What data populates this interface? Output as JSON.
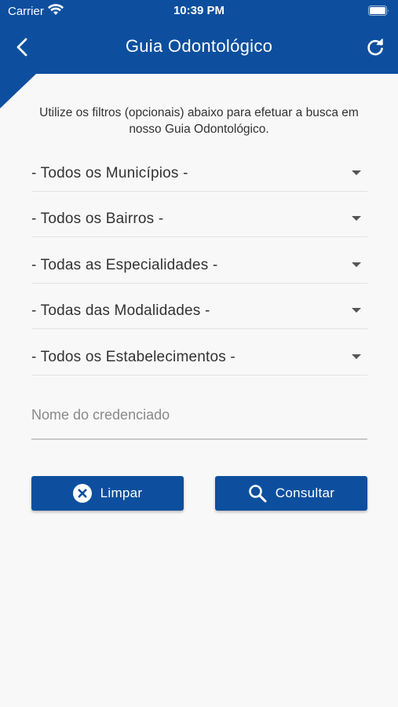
{
  "status_bar": {
    "carrier": "Carrier",
    "time": "10:39 PM"
  },
  "header": {
    "title": "Guia Odontológico",
    "back_icon": "chevron-left-icon",
    "refresh_icon": "refresh-icon",
    "color": "#0d4f9e"
  },
  "intro_text": "Utilize os filtros (opcionais) abaixo para efetuar a busca em nosso Guia Odontológico.",
  "filters": [
    {
      "label": "- Todos os Municípios -"
    },
    {
      "label": "- Todos os Bairros -"
    },
    {
      "label": "- Todas as Especialidades -"
    },
    {
      "label": "- Todas das Modalidades -"
    },
    {
      "label": "- Todos os Estabelecimentos -"
    }
  ],
  "name_field": {
    "placeholder": "Nome do credenciado",
    "value": ""
  },
  "buttons": {
    "clear_label": "Limpar",
    "clear_icon": "close-circle-icon",
    "search_label": "Consultar",
    "search_icon": "search-icon"
  }
}
